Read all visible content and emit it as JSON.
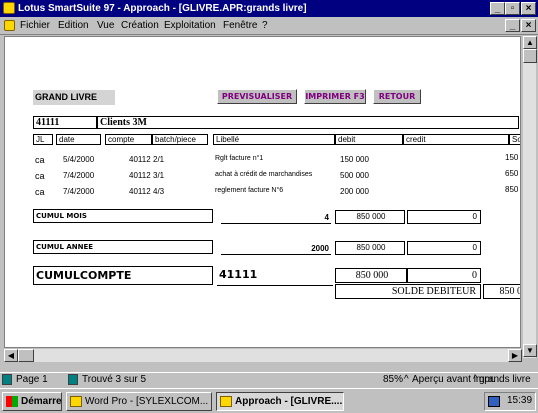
{
  "window": {
    "title": "Lotus SmartSuite 97  -  Approach - [GLIVRE.APR:grands livre]"
  },
  "menu": {
    "items": [
      "Fichier",
      "Edition",
      "Vue",
      "Création",
      "Exploitation",
      "Fenêtre",
      "?"
    ]
  },
  "report": {
    "header_label": "GRAND LIVRE",
    "buttons": {
      "preview": "PREVISUALISER",
      "print": "IMPRIMER F3",
      "back": "RETOUR"
    },
    "account_number": "41111",
    "account_name": "Clients 3M",
    "columns": [
      "JL",
      "date",
      "compte",
      "batch/piece",
      "Libellé",
      "debit",
      "credit",
      "Solde"
    ],
    "rows": [
      {
        "jl": "ca",
        "date": "5/4/2000",
        "compte": "40112",
        "piece": "2/1",
        "libelle": "Rglt facture n°1",
        "debit": "150 000",
        "solde": "150"
      },
      {
        "jl": "ca",
        "date": "7/4/2000",
        "compte": "40112",
        "piece": "3/1",
        "libelle": "achat à crédit de marchandises",
        "debit": "500 000",
        "solde": "650"
      },
      {
        "jl": "ca",
        "date": "7/4/2000",
        "compte": "40112",
        "piece": "4/3",
        "libelle": "reglement facture N°6",
        "debit": "200 000",
        "solde": "850"
      }
    ],
    "cumul_mois": {
      "label": "CUMUL MOIS",
      "period": "4",
      "debit": "850 000",
      "credit": "0"
    },
    "cumul_annee": {
      "label": "CUMUL ANNEE",
      "period": "2000",
      "debit": "850 000",
      "credit": "0"
    },
    "cumul_compte": {
      "label": "CUMULCOMPTE",
      "account": "41111",
      "debit": "850 000",
      "credit": "0",
      "solde_label": "SOLDE DEBITEUR",
      "solde": "850 0"
    }
  },
  "status": {
    "page": "Page 1",
    "found": "Trouvé 3 sur 5",
    "zoom": "85%",
    "mode": "Aperçu avant impr.",
    "view": "grands livre"
  },
  "taskbar": {
    "start": "Démarrer",
    "task1": "Word Pro - [SYLEXLCOM...",
    "task2": "Approach - [GLIVRE....",
    "clock": "15:39"
  }
}
